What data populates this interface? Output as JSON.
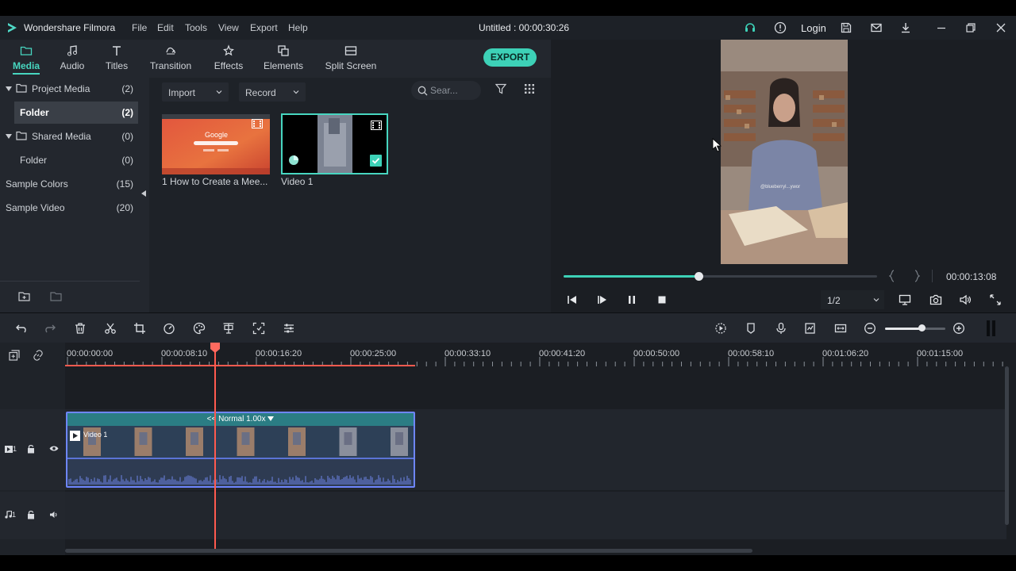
{
  "app": {
    "name": "Wondershare Filmora",
    "document": "Untitled : 00:00:30:26",
    "login_label": "Login"
  },
  "menu": [
    "File",
    "Edit",
    "Tools",
    "View",
    "Export",
    "Help"
  ],
  "tabs": [
    {
      "label": "Media",
      "icon": "folder-icon",
      "active": true
    },
    {
      "label": "Audio",
      "icon": "music-note-icon"
    },
    {
      "label": "Titles",
      "icon": "text-t-icon"
    },
    {
      "label": "Transition",
      "icon": "transition-icon"
    },
    {
      "label": "Effects",
      "icon": "effects-icon"
    },
    {
      "label": "Elements",
      "icon": "elements-icon"
    },
    {
      "label": "Split Screen",
      "icon": "split-screen-icon"
    }
  ],
  "export_label": "EXPORT",
  "sidebar": {
    "items": [
      {
        "label": "Project Media",
        "count": "(2)"
      },
      {
        "label": "Folder",
        "count": "(2)"
      },
      {
        "label": "Shared Media",
        "count": "(0)"
      },
      {
        "label": "Folder",
        "count": "(0)"
      },
      {
        "label": "Sample Colors",
        "count": "(15)"
      },
      {
        "label": "Sample Video",
        "count": "(20)"
      }
    ]
  },
  "media": {
    "import_label": "Import",
    "record_label": "Record",
    "search_placeholder": "Sear...",
    "items": [
      {
        "label": "1 How to Create a Mee...",
        "thumb_text": "Google"
      },
      {
        "label": "Video 1"
      }
    ]
  },
  "preview": {
    "timecode": "00:00:13:08",
    "quality": "1/2",
    "progress": 0.43,
    "video_caption": "@blueberryl...ywor"
  },
  "timeline": {
    "ruler": [
      "00:00:00:00",
      "00:00:08:10",
      "00:00:16:20",
      "00:00:25:00",
      "00:00:33:10",
      "00:00:41:20",
      "00:00:50:00",
      "00:00:58:10",
      "00:01:06:20",
      "00:01:15:00"
    ],
    "clip": {
      "label": "Video 1",
      "speed": "<< Normal 1.00x"
    },
    "video_track": "1",
    "audio_track": "1",
    "zoom_level": 0.6
  }
}
